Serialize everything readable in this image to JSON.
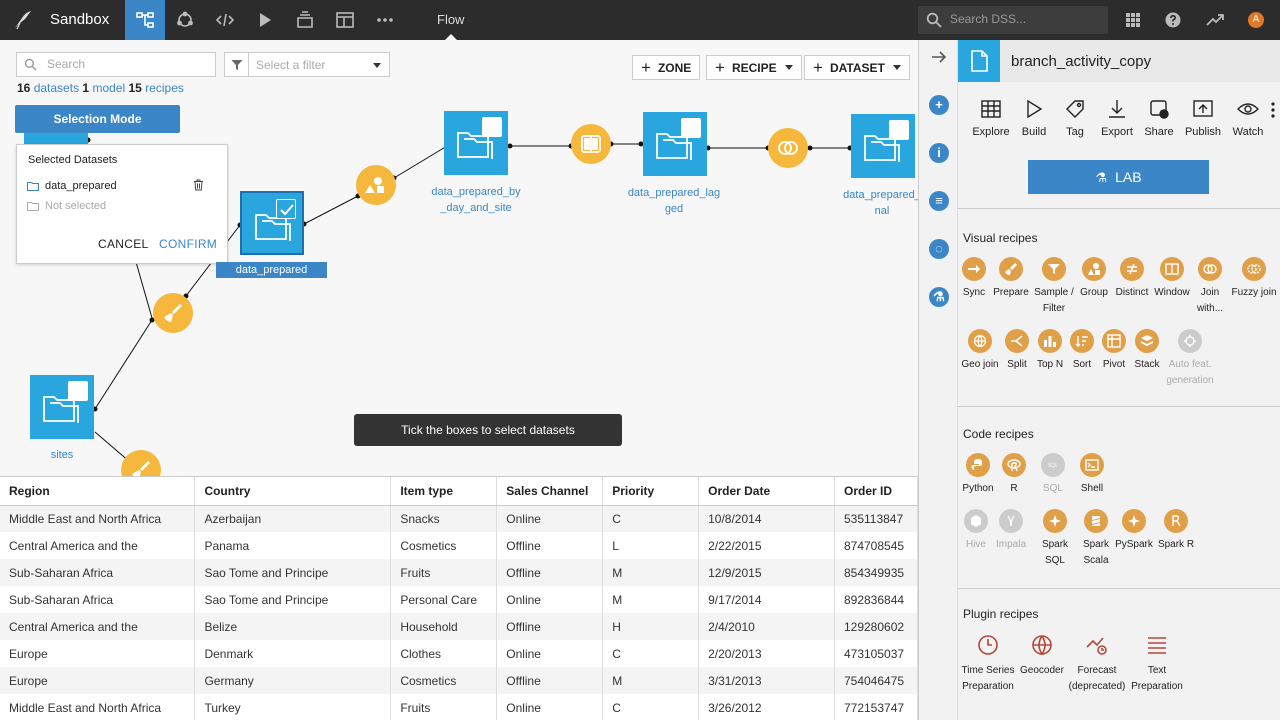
{
  "topbar": {
    "project": "Sandbox",
    "current_view": "Flow",
    "search_placeholder": "Search DSS...",
    "avatar_initial": "A"
  },
  "flow": {
    "search_placeholder": "Search",
    "filter_placeholder": "Select a filter",
    "counts": {
      "datasets_num": "16",
      "datasets_label": "datasets",
      "models_num": "1",
      "models_label": "model",
      "recipes_num": "15",
      "recipes_label": "recipes"
    },
    "buttons": {
      "zone": "ZONE",
      "recipe": "RECIPE",
      "dataset": "DATASET"
    },
    "selection_mode": {
      "title": "Selection Mode",
      "panel_title": "Selected Datasets",
      "selected": "data_prepared",
      "not_selected": "Not selected",
      "cancel": "CANCEL",
      "confirm": "CONFIRM"
    },
    "nodes": {
      "data_prepared": "data_prepared",
      "by_day_site_1": "data_prepared_by",
      "by_day_site_2": "_day_and_site",
      "lagged_1": "data_prepared_lag",
      "lagged_2": "ged",
      "final_1": "data_prepared_",
      "final_2": "nal",
      "sites": "sites"
    },
    "toast": "Tick the boxes to select datasets"
  },
  "table": {
    "columns": [
      "Region",
      "Country",
      "Item type",
      "Sales Channel",
      "Priority",
      "Order Date",
      "Order ID"
    ],
    "rows": [
      [
        "Middle East and North Africa",
        "Azerbaijan",
        "Snacks",
        "Online",
        "C",
        "10/8/2014",
        "535113847"
      ],
      [
        "Central America and the",
        "Panama",
        "Cosmetics",
        "Offline",
        "L",
        "2/22/2015",
        "874708545"
      ],
      [
        "Sub-Saharan Africa",
        "Sao Tome and Principe",
        "Fruits",
        "Offline",
        "M",
        "12/9/2015",
        "854349935"
      ],
      [
        "Sub-Saharan Africa",
        "Sao Tome and Principe",
        "Personal Care",
        "Online",
        "M",
        "9/17/2014",
        "892836844"
      ],
      [
        "Central America and the",
        "Belize",
        "Household",
        "Offline",
        "H",
        "2/4/2010",
        "129280602"
      ],
      [
        "Europe",
        "Denmark",
        "Clothes",
        "Online",
        "C",
        "2/20/2013",
        "473105037"
      ],
      [
        "Europe",
        "Germany",
        "Cosmetics",
        "Offline",
        "M",
        "3/31/2013",
        "754046475"
      ],
      [
        "Middle East and North Africa",
        "Turkey",
        "Fruits",
        "Online",
        "C",
        "3/26/2012",
        "772153747"
      ]
    ]
  },
  "right_panel": {
    "dataset_name": "branch_activity_copy",
    "actions": {
      "explore": "Explore",
      "build": "Build",
      "tag": "Tag",
      "export": "Export",
      "share": "Share",
      "publish": "Publish",
      "watch": "Watch"
    },
    "lab": "LAB",
    "visual_title": "Visual recipes",
    "visual": {
      "sync": "Sync",
      "prepare": "Prepare",
      "sample_1": "Sample /",
      "sample_2": "Filter",
      "group": "Group",
      "distinct": "Distinct",
      "window": "Window",
      "join_1": "Join",
      "join_2": "with...",
      "fuzzy": "Fuzzy join",
      "geo": "Geo join",
      "split": "Split",
      "topn": "Top N",
      "sort": "Sort",
      "pivot": "Pivot",
      "stack": "Stack",
      "auto_1": "Auto feat.",
      "auto_2": "generation"
    },
    "code_title": "Code recipes",
    "code": {
      "python": "Python",
      "r": "R",
      "sql": "SQL",
      "shell": "Shell",
      "hive": "Hive",
      "impala": "Impala",
      "sparksql": "Spark SQL",
      "sparkscala_1": "Spark",
      "sparkscala_2": "Scala",
      "pyspark": "PySpark",
      "sparkr": "Spark R"
    },
    "plugin_title": "Plugin recipes",
    "plugin": {
      "ts_1": "Time Series",
      "ts_2": "Preparation",
      "geocoder": "Geocoder",
      "forecast_1": "Forecast",
      "forecast_2": "(deprecated)",
      "text_1": "Text",
      "text_2": "Preparation"
    }
  },
  "colors": {
    "accent": "#3b86c6",
    "dataset": "#2aa6df",
    "recipe": "#f5b83d",
    "topbar": "#2c2c2c"
  }
}
